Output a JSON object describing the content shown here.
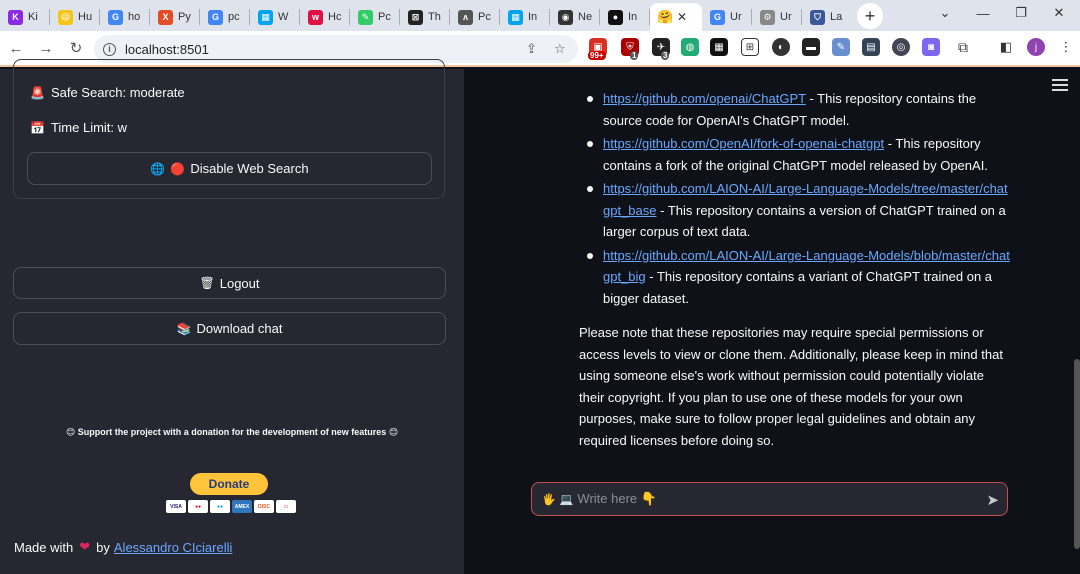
{
  "browser": {
    "tabs": [
      {
        "title": "Ki",
        "color": "#8a2be2",
        "glyph": "K"
      },
      {
        "title": "Hu",
        "color": "#f5c518",
        "glyph": "😃"
      },
      {
        "title": "ho",
        "color": "#4285f4",
        "glyph": "G"
      },
      {
        "title": "Py",
        "color": "#e34c26",
        "glyph": "X"
      },
      {
        "title": "pc",
        "color": "#4285f4",
        "glyph": "G"
      },
      {
        "title": "W",
        "color": "#00a4ef",
        "glyph": "▦"
      },
      {
        "title": "Hc",
        "color": "#d14",
        "glyph": "w"
      },
      {
        "title": "Pc",
        "color": "#3c6",
        "glyph": "✎"
      },
      {
        "title": "Th",
        "color": "#222",
        "glyph": "⊠"
      },
      {
        "title": "Pc",
        "color": "#555",
        "glyph": "ʌ"
      },
      {
        "title": "In",
        "color": "#00a4ef",
        "glyph": "▦"
      },
      {
        "title": "Ne",
        "color": "#333",
        "glyph": "◉"
      },
      {
        "title": "In",
        "color": "#111",
        "glyph": "●"
      }
    ],
    "active_tab": {
      "title": "",
      "glyph": "🤗"
    },
    "after_tabs": [
      {
        "title": "Ur",
        "color": "#4285f4",
        "glyph": "G"
      },
      {
        "title": "Ur",
        "color": "#888",
        "glyph": "⚙"
      },
      {
        "title": "La",
        "color": "#3b5998",
        "glyph": "⛉"
      }
    ],
    "url": "localhost:8501",
    "extension_badges": {
      "b1": "99+",
      "b2": "1",
      "b3": "3"
    }
  },
  "sidebar": {
    "safe_search": "Safe Search: moderate",
    "time_limit": "Time Limit: w",
    "disable_web_search": "Disable Web Search",
    "logout": "Logout",
    "download_chat": "Download chat",
    "support_text": "Support the project with a donation for the development of new features",
    "donate_label": "Donate",
    "made_with": "Made with",
    "made_by": "by",
    "author": "Alessandro CIciarelli"
  },
  "main": {
    "items": [
      {
        "link": "https://github.com/openai/ChatGPT",
        "text": " - This repository contains the source code for OpenAI's ChatGPT model."
      },
      {
        "link": "https://github.com/OpenAI/fork-of-openai-chatgpt",
        "text": " - This repository contains a fork of the original ChatGPT model released by OpenAI."
      },
      {
        "link": "https://github.com/LAION-AI/Large-Language-Models/tree/master/chatgpt_base",
        "text": " - This repository contains a version of ChatGPT trained on a larger corpus of text data."
      },
      {
        "link": "https://github.com/LAION-AI/Large-Language-Models/blob/master/chatgpt_big",
        "text": " - This repository contains a variant of ChatGPT trained on a bigger dataset."
      }
    ],
    "note": "Please note that these repositories may require special permissions or access levels to view or clone them. Additionally, please keep in mind that using someone else's work without permission could potentially violate their copyright. If you plan to use one of these models for your own purposes, make sure to follow proper legal guidelines and obtain any required licenses before doing so.",
    "input_placeholder": "Write here 👇"
  }
}
